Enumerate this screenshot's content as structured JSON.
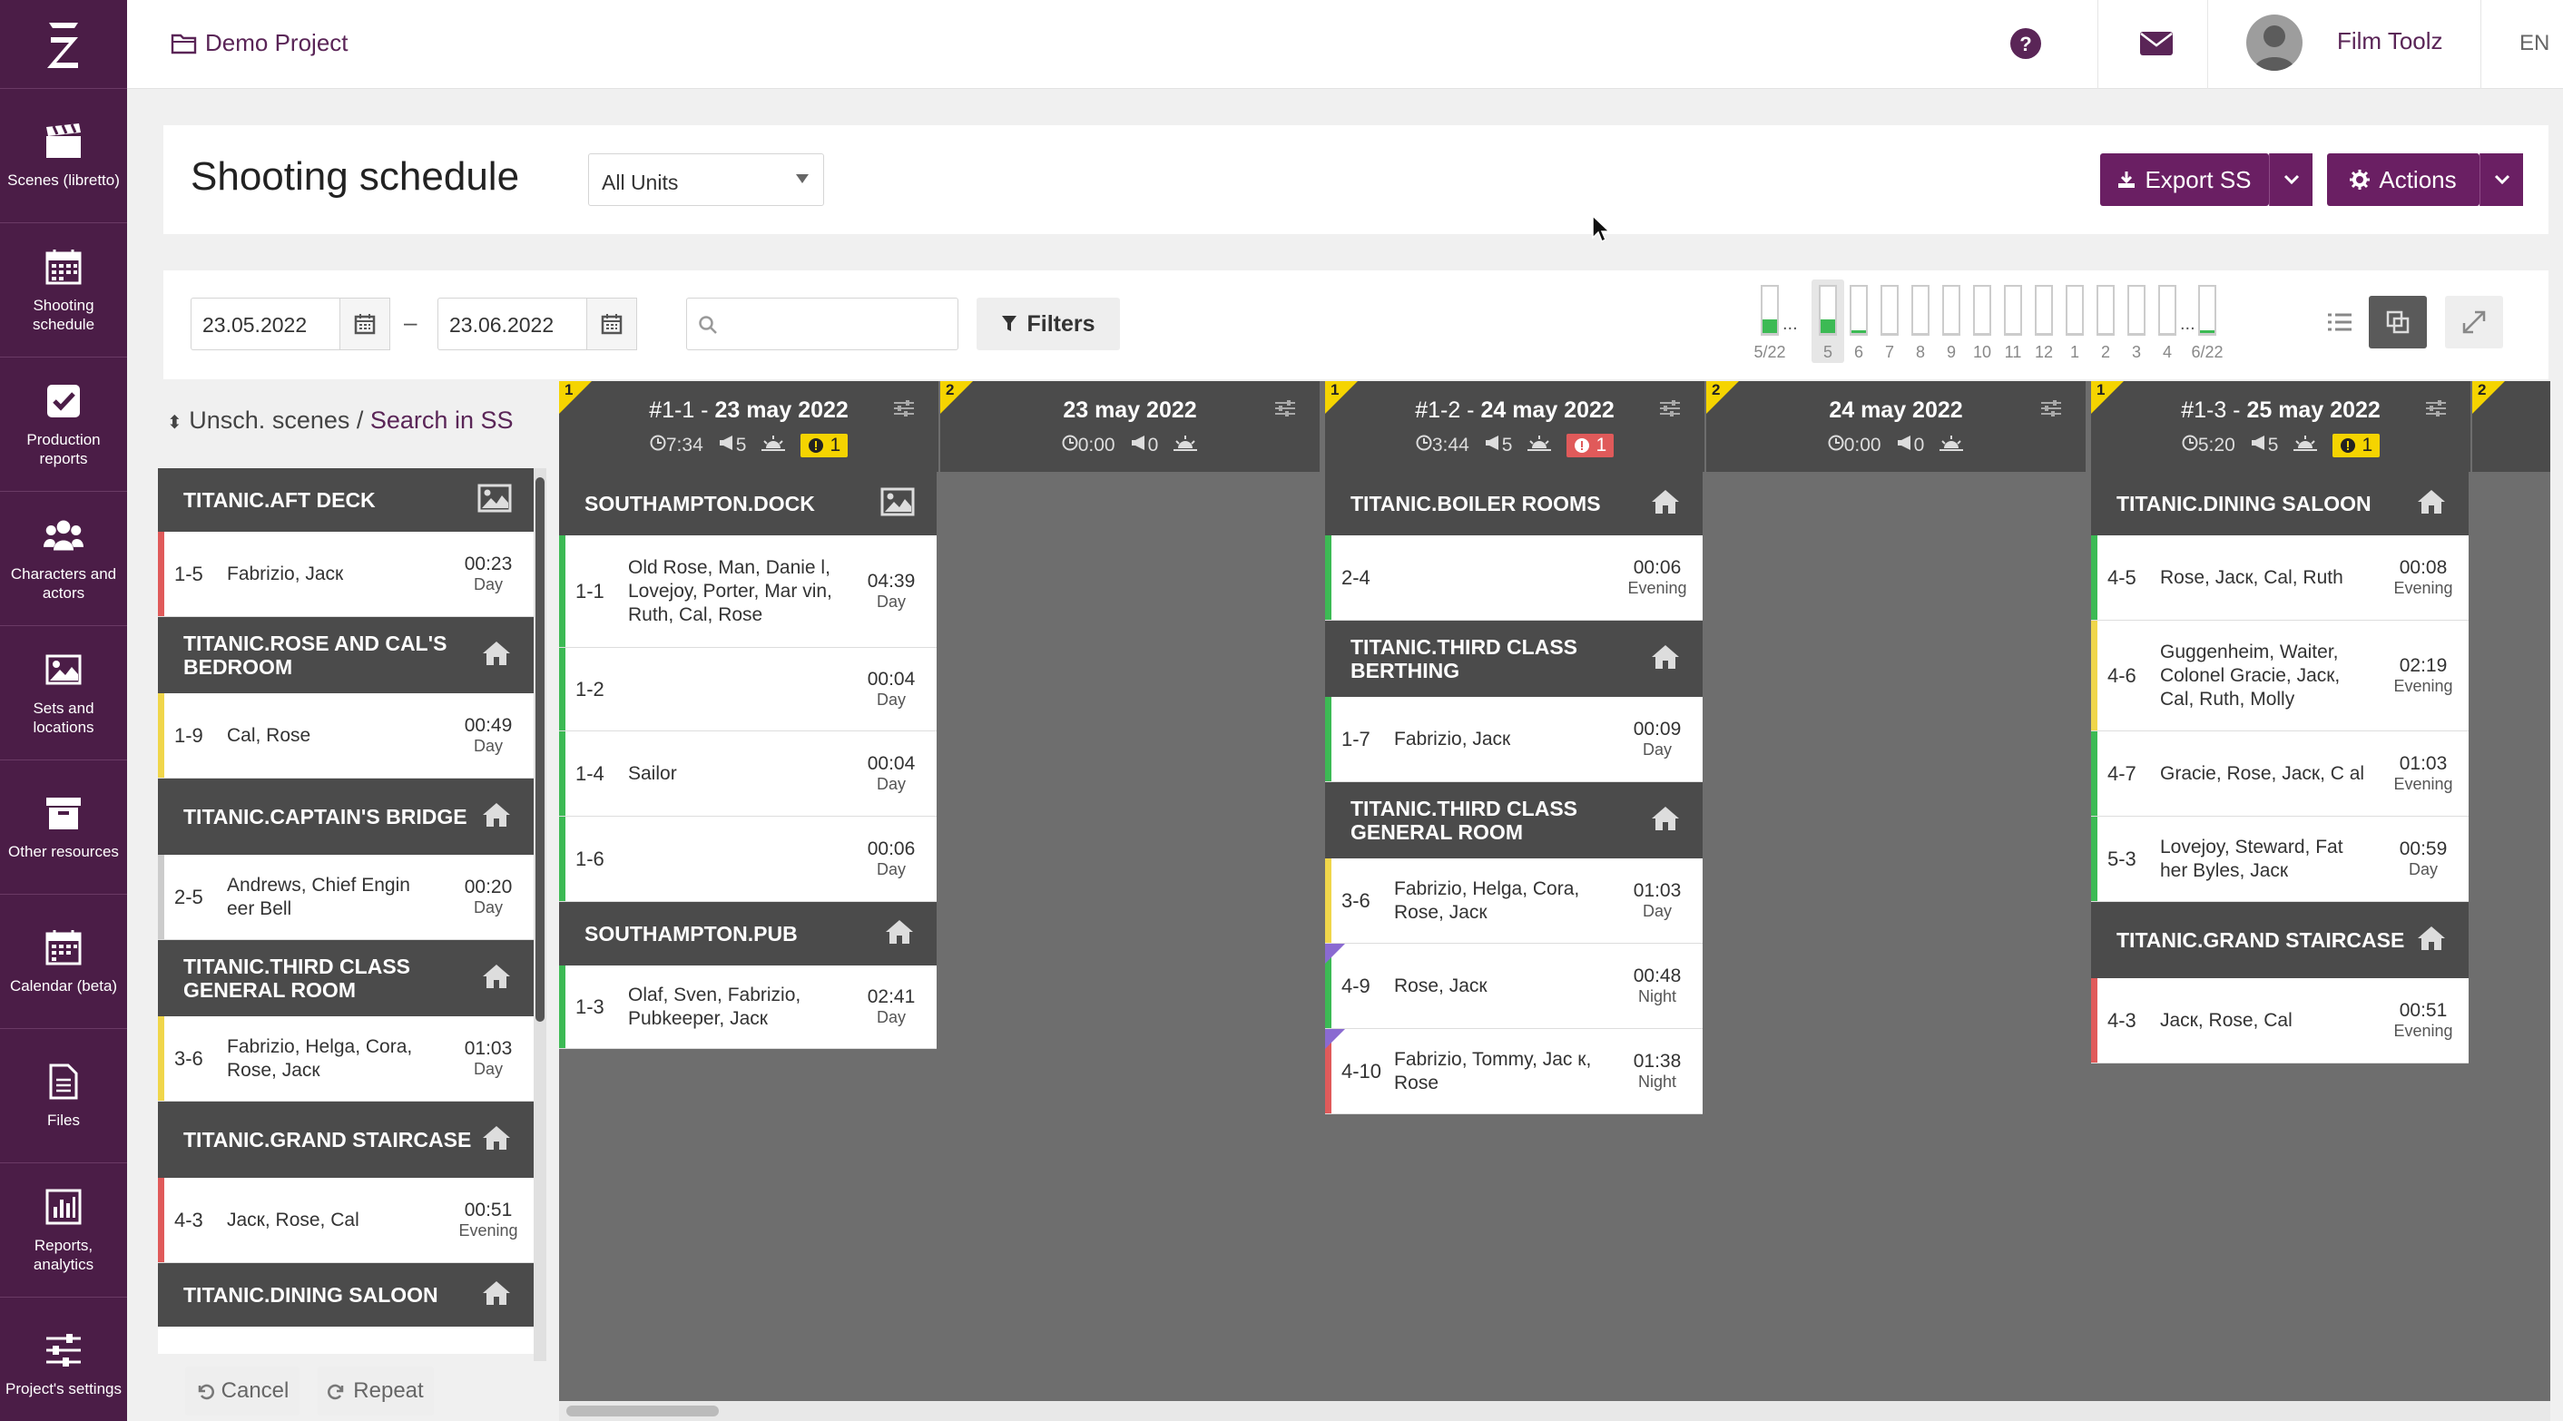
{
  "app": {
    "project_name": "Demo Project",
    "user_name": "Film Toolz",
    "language": "EN"
  },
  "sidebar": {
    "items": [
      {
        "label": "Scenes (libretto)",
        "icon": "clapperboard-icon"
      },
      {
        "label": "Shooting schedule",
        "icon": "calendar-grid-icon"
      },
      {
        "label": "Production reports",
        "icon": "checkbox-icon"
      },
      {
        "label": "Characters and actors",
        "icon": "users-icon"
      },
      {
        "label": "Sets and locations",
        "icon": "image-icon"
      },
      {
        "label": "Other resources",
        "icon": "archive-icon"
      },
      {
        "label": "Calendar (beta)",
        "icon": "calendar-icon"
      },
      {
        "label": "Files",
        "icon": "file-icon"
      },
      {
        "label": "Reports, analytics",
        "icon": "bar-chart-icon"
      },
      {
        "label": "Project's settings",
        "icon": "sliders-icon"
      }
    ]
  },
  "header": {
    "title": "Shooting schedule",
    "units_select": "All Units",
    "export_label": "Export SS",
    "actions_label": "Actions"
  },
  "toolbar": {
    "date_from": "23.05.2022",
    "date_to": "23.06.2022",
    "dash": "–",
    "search_placeholder": "",
    "filters_label": "Filters",
    "mini_days": [
      {
        "label": "5/22",
        "fill": 0.3,
        "dots": true
      },
      {
        "label": "5",
        "fill": 0.3,
        "selected": true
      },
      {
        "label": "6",
        "fill": 0.05
      },
      {
        "label": "7",
        "fill": 0
      },
      {
        "label": "8",
        "fill": 0
      },
      {
        "label": "9",
        "fill": 0
      },
      {
        "label": "10",
        "fill": 0
      },
      {
        "label": "11",
        "fill": 0
      },
      {
        "label": "12",
        "fill": 0
      },
      {
        "label": "1",
        "fill": 0
      },
      {
        "label": "2",
        "fill": 0
      },
      {
        "label": "3",
        "fill": 0
      },
      {
        "label": "4",
        "fill": 0,
        "dots": true
      },
      {
        "label": "6/22",
        "fill": 0.05
      }
    ],
    "ellipsis": "..."
  },
  "unscheduled": {
    "title_prefix": "Unsch. scenes",
    "separator": " / ",
    "title_link": "Search in SS",
    "cancel_label": "Cancel",
    "repeat_label": "Repeat",
    "groups": [
      {
        "set": "TITANIC.AFT DECK",
        "icon": "image-icon",
        "scenes": [
          {
            "num": "1-5",
            "chars": "Fabrizio, Jacк",
            "time": "00:23",
            "tod": "Day",
            "color": "#e05a5a"
          }
        ]
      },
      {
        "set": "TITANIC.ROSE AND CAL'S BEDROOM",
        "icon": "home-icon",
        "scenes": [
          {
            "num": "1-9",
            "chars": "Cal, Rose",
            "time": "00:49",
            "tod": "Day",
            "color": "#f0d64a"
          }
        ]
      },
      {
        "set": "TITANIC.CAPTAIN'S BRIDGE",
        "icon": "home-icon",
        "scenes": [
          {
            "num": "2-5",
            "chars": "Andrews, Chief Engin eer Bell",
            "time": "00:20",
            "tod": "Day",
            "color": "#cccccc"
          }
        ]
      },
      {
        "set": "TITANIC.THIRD CLASS GENERAL ROOM",
        "icon": "home-icon",
        "scenes": [
          {
            "num": "3-6",
            "chars": "Fabrizio, Helga, Cora, Rose, Jacк",
            "time": "01:03",
            "tod": "Day",
            "color": "#f0d64a"
          }
        ]
      },
      {
        "set": "TITANIC.GRAND STAIRCASE",
        "icon": "home-icon",
        "scenes": [
          {
            "num": "4-3",
            "chars": "Jacк, Rose, Cal",
            "time": "00:51",
            "tod": "Evening",
            "color": "#e05a5a"
          }
        ]
      },
      {
        "set": "TITANIC.DINING SALOON",
        "icon": "home-icon",
        "scenes": []
      }
    ]
  },
  "days": [
    {
      "corner": "1",
      "prefix": "#1-1 - ",
      "date": "23 may 2022",
      "time": "7:34",
      "scenes": "5",
      "warn": "1",
      "warn_color": "#f5d400",
      "groups": [
        {
          "set": "SOUTHAMPTON.DOCK",
          "icon": "image-icon",
          "scenes": [
            {
              "num": "1-1",
              "chars": "Old Rose, Man, Danie l, Lovejoy, Porter, Mar vin, Ruth, Cal, Rose",
              "time": "04:39",
              "tod": "Day",
              "color": "#3cba54",
              "h": 124
            },
            {
              "num": "1-2",
              "chars": "",
              "time": "00:04",
              "tod": "Day",
              "color": "#3cba54",
              "h": 92
            },
            {
              "num": "1-4",
              "chars": "Sailor",
              "time": "00:04",
              "tod": "Day",
              "color": "#3cba54",
              "h": 94
            },
            {
              "num": "1-6",
              "chars": "",
              "time": "00:06",
              "tod": "Day",
              "color": "#3cba54",
              "h": 94
            }
          ]
        },
        {
          "set": "SOUTHAMPTON.PUB",
          "icon": "home-icon",
          "scenes": [
            {
              "num": "1-3",
              "chars": "Olaf, Sven, Fabrizio, Pubkeeper, Jacк",
              "time": "02:41",
              "tod": "Day",
              "color": "#3cba54",
              "h": 92
            }
          ]
        }
      ]
    },
    {
      "corner": "2",
      "prefix": "",
      "date": "23 may 2022",
      "time": "0:00",
      "scenes": "0",
      "warn": "",
      "groups": []
    },
    {
      "corner": "1",
      "prefix": "#1-2 - ",
      "date": "24 may 2022",
      "time": "3:44",
      "scenes": "5",
      "warn": "1",
      "warn_color": "#e05a5a",
      "groups": [
        {
          "set": "TITANIC.BOILER ROOMS",
          "icon": "home-icon",
          "scenes": [
            {
              "num": "2-4",
              "chars": "",
              "time": "00:06",
              "tod": "Evening",
              "color": "#3cba54",
              "h": 94
            }
          ]
        },
        {
          "set": "TITANIC.THIRD CLASS BERTHING",
          "icon": "home-icon",
          "scenes": [
            {
              "num": "1-7",
              "chars": "Fabrizio, Jacк",
              "time": "00:09",
              "tod": "Day",
              "color": "#3cba54",
              "h": 94
            }
          ]
        },
        {
          "set": "TITANIC.THIRD CLASS GENERAL ROOM",
          "icon": "home-icon",
          "scenes": [
            {
              "num": "3-6",
              "chars": "Fabrizio, Helga, Cora, Rose, Jacк",
              "time": "01:03",
              "tod": "Day",
              "color": "#f0d64a",
              "h": 94
            },
            {
              "num": "4-9",
              "chars": "Rose, Jacк",
              "time": "00:48",
              "tod": "Night",
              "color": "#3cba54",
              "h": 94,
              "stripe": true
            },
            {
              "num": "4-10",
              "chars": "Fabrizio, Tommy, Jac к, Rose",
              "time": "01:38",
              "tod": "Night",
              "color": "#e05a5a",
              "h": 94,
              "stripe": true
            }
          ]
        }
      ]
    },
    {
      "corner": "2",
      "prefix": "",
      "date": "24 may 2022",
      "time": "0:00",
      "scenes": "0",
      "warn": "",
      "groups": []
    },
    {
      "corner": "1",
      "prefix": "#1-3 - ",
      "date": "25 may 2022",
      "time": "5:20",
      "scenes": "5",
      "warn": "1",
      "warn_color": "#f5d400",
      "groups": [
        {
          "set": "TITANIC.DINING SALOON",
          "icon": "home-icon",
          "scenes": [
            {
              "num": "4-5",
              "chars": "Rose, Jacк, Cal, Ruth",
              "time": "00:08",
              "tod": "Evening",
              "color": "#3cba54",
              "h": 94
            },
            {
              "num": "4-6",
              "chars": "Guggenheim, Waiter, Colonel Gracie, Jacк, Cal, Ruth, Molly",
              "time": "02:19",
              "tod": "Evening",
              "color": "#f0d64a",
              "h": 122
            },
            {
              "num": "4-7",
              "chars": "Gracie, Rose, Jacк, C al",
              "time": "01:03",
              "tod": "Evening",
              "color": "#3cba54",
              "h": 94
            },
            {
              "num": "5-3",
              "chars": "Lovejoy, Steward, Fat her Byles, Jacк",
              "time": "00:59",
              "tod": "Day",
              "color": "#3cba54",
              "h": 94
            }
          ]
        },
        {
          "set": "TITANIC.GRAND STAIRCASE",
          "icon": "home-icon",
          "scenes": [
            {
              "num": "4-3",
              "chars": "Jacк, Rose, Cal",
              "time": "00:51",
              "tod": "Evening",
              "color": "#e05a5a",
              "h": 94
            }
          ]
        }
      ]
    },
    {
      "corner": "2",
      "prefix": "",
      "date": "",
      "time": "",
      "scenes": "",
      "warn": "",
      "groups": []
    }
  ]
}
